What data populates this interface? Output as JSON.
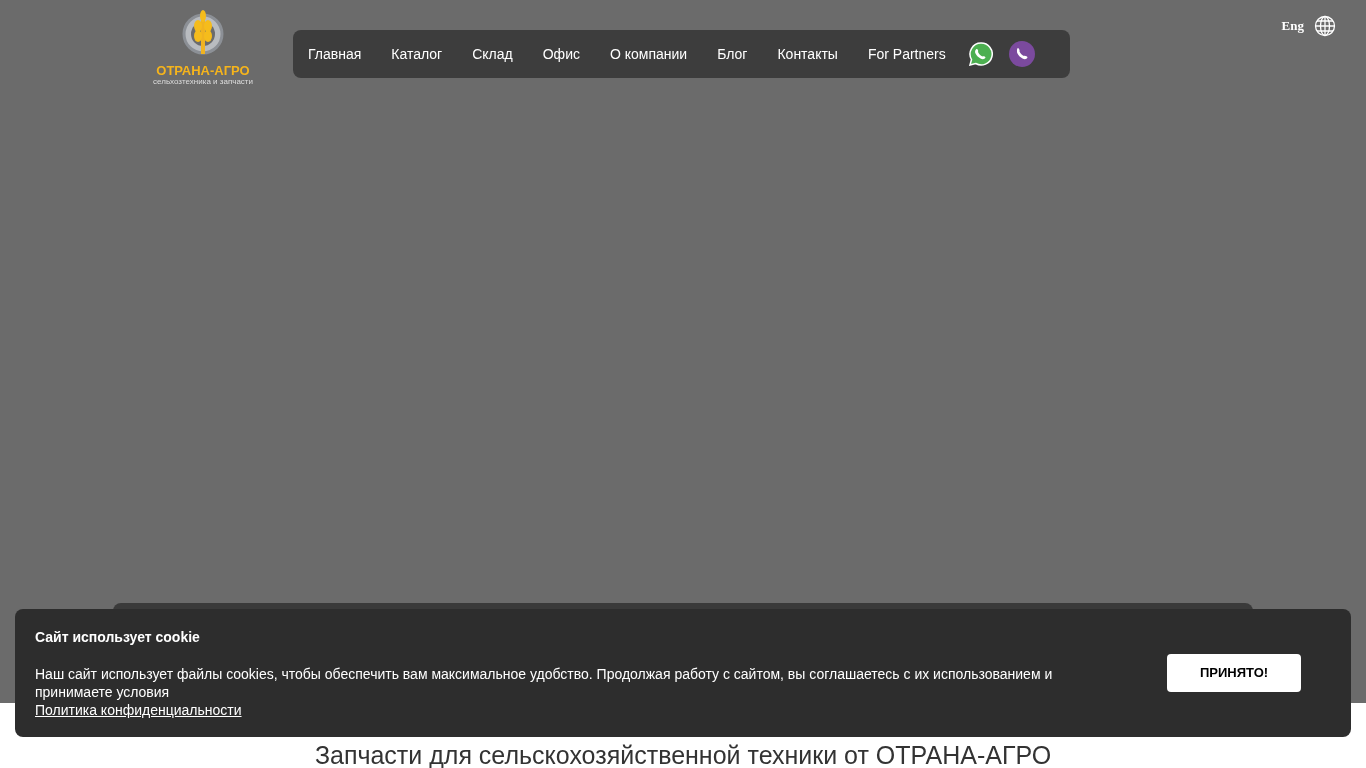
{
  "logo": {
    "name": "ОТРАНА-АГРО",
    "tagline": "сельхозтехника и запчасти"
  },
  "nav": [
    {
      "label": "Главная"
    },
    {
      "label": "Каталог"
    },
    {
      "label": "Склад"
    },
    {
      "label": "Офис"
    },
    {
      "label": "О компании"
    },
    {
      "label": "Блог"
    },
    {
      "label": "Контакты"
    },
    {
      "label": "For Partners"
    }
  ],
  "language": "Eng",
  "heading": "Запчасти для сельскохозяйственной техники от ОТРАНА-АГРО",
  "cookie": {
    "title": "Сайт использует cookie",
    "text": "Наш сайт использует файлы cookies, чтобы обеспечить вам максимальное удобство. Продолжая работу с сайтом, вы соглашаетесь с их использованием и принимаете условия",
    "link": "Политика конфиденциальности",
    "button": "ПРИНЯТО!"
  }
}
